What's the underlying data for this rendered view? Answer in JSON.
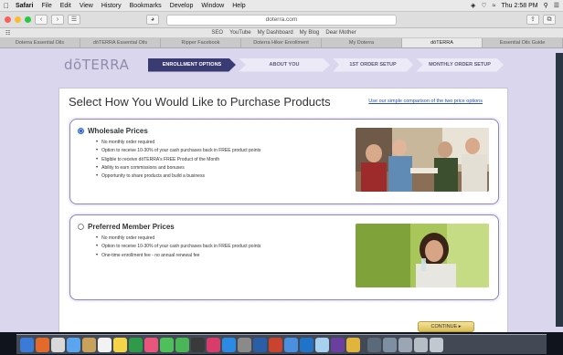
{
  "menubar": {
    "apple": "",
    "items": [
      "Safari",
      "File",
      "Edit",
      "View",
      "History",
      "Bookmarks",
      "Develop",
      "Window",
      "Help"
    ],
    "clock": "Thu 2:58 PM"
  },
  "toolbar": {
    "sidebar_btn": "",
    "back": "‹",
    "forward": "›",
    "url": "doterra.com",
    "share": "⇪",
    "tabs_btn": "⧉"
  },
  "bookmarks": [
    "SEO",
    "YouTube",
    "My Dashboard",
    "My Blog",
    "Dear Mother"
  ],
  "tabs": [
    {
      "label": "Doterra Essential Oils",
      "active": false
    },
    {
      "label": "dōTERRA Essential Oils",
      "active": false
    },
    {
      "label": "Ripper Facebook",
      "active": false
    },
    {
      "label": "Doterra Hiker Enrollment",
      "active": false
    },
    {
      "label": "My Doterra",
      "active": false
    },
    {
      "label": "dōTERRA",
      "active": true
    },
    {
      "label": "Essential Oils Guide",
      "active": false
    }
  ],
  "page": {
    "logo": "dōTERRA",
    "steps": [
      {
        "label": "ENROLLMENT OPTIONS",
        "active": true
      },
      {
        "label": "ABOUT YOU",
        "active": false
      },
      {
        "label": "1ST ORDER SETUP",
        "active": false
      },
      {
        "label": "MONTHLY ORDER SETUP",
        "active": false
      }
    ],
    "heading": "Select How You Would Like to Purchase Products",
    "compare_link": "Use our simple comparison of the two price options",
    "wholesale": {
      "title": "Wholesale Prices",
      "selected": true,
      "bullets": [
        "No monthly order required",
        "Option to receive 10-30% of your cash purchases back in FREE product points",
        "Eligible to receive dōTERRA's FREE Product of the Month",
        "Ability to earn commissions and bonuses",
        "Opportunity to share products and build a business"
      ]
    },
    "preferred": {
      "title": "Preferred Member Prices",
      "selected": false,
      "bullets": [
        "No monthly order required",
        "Option to receive 10-30% of your cash purchases back in FREE product points",
        "One-time enrollment fee - no annual renewal fee"
      ]
    },
    "continue_label": "CONTINUE ▸"
  },
  "colors": {
    "accent": "#3a3b72",
    "link": "#2c4fa8",
    "page_bg": "#dad6ee",
    "card_border": "#8d83b6"
  }
}
